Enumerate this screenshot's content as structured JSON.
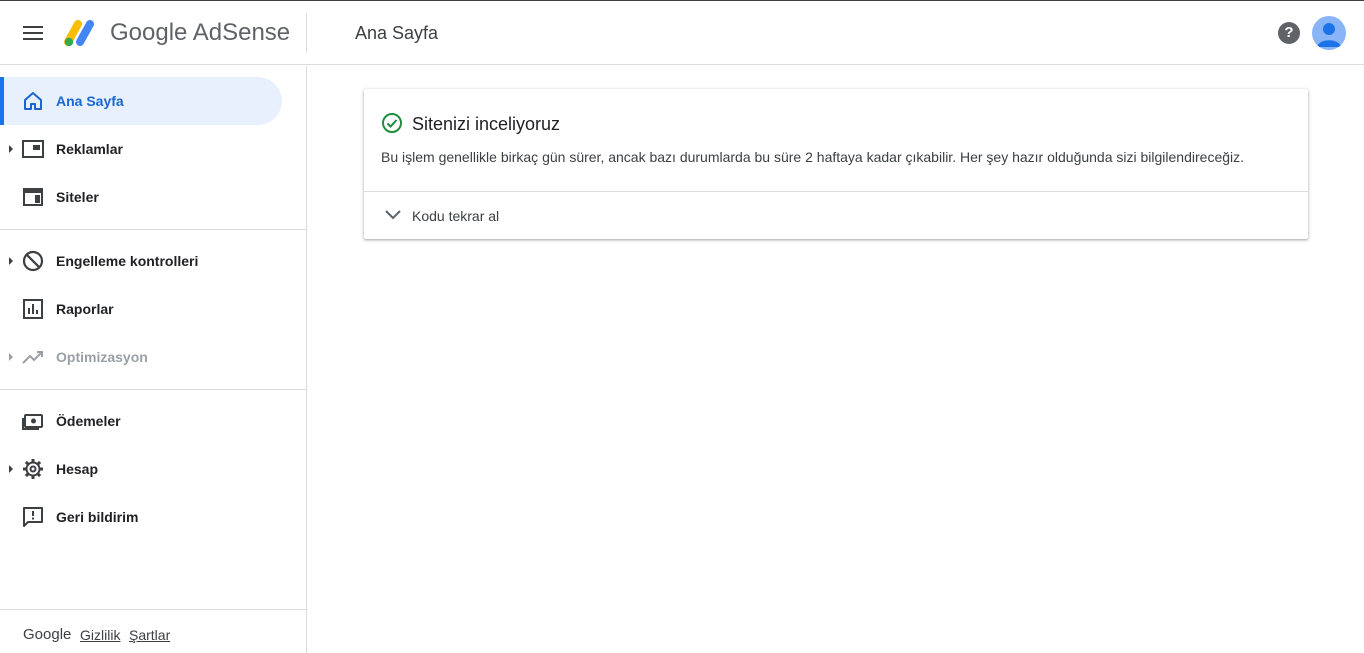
{
  "header": {
    "brand_google": "Google",
    "brand_product": "AdSense",
    "page_title": "Ana Sayfa",
    "help_glyph": "?"
  },
  "nav": {
    "items": [
      {
        "label": "Ana Sayfa",
        "icon": "home-icon",
        "active": true,
        "expandable": false
      },
      {
        "label": "Reklamlar",
        "icon": "ads-icon",
        "active": false,
        "expandable": true
      },
      {
        "label": "Siteler",
        "icon": "sites-icon",
        "active": false,
        "expandable": false
      },
      {
        "label": "Engelleme kontrolleri",
        "icon": "block-icon",
        "active": false,
        "expandable": true
      },
      {
        "label": "Raporlar",
        "icon": "reports-icon",
        "active": false,
        "expandable": false
      },
      {
        "label": "Optimizasyon",
        "icon": "trending-up-icon",
        "active": false,
        "expandable": true,
        "disabled": true
      },
      {
        "label": "Ödemeler",
        "icon": "payments-icon",
        "active": false,
        "expandable": false
      },
      {
        "label": "Hesap",
        "icon": "gear-icon",
        "active": false,
        "expandable": true
      },
      {
        "label": "Geri bildirim",
        "icon": "feedback-icon",
        "active": false,
        "expandable": false
      }
    ]
  },
  "footer": {
    "brand": "Google",
    "privacy": "Gizlilik",
    "terms": "Şartlar"
  },
  "card": {
    "title": "Sitenizi inceliyoruz",
    "description": "Bu işlem genellikle birkaç gün sürer, ancak bazı durumlarda bu süre 2 haftaya kadar çıkabilir. Her şey hazır olduğunda sizi bilgilendireceğiz.",
    "expand_label": "Kodu tekrar al"
  },
  "colors": {
    "accent": "#1a73e8",
    "active_bg": "#e8f0fe",
    "success": "#1e8e3e"
  }
}
